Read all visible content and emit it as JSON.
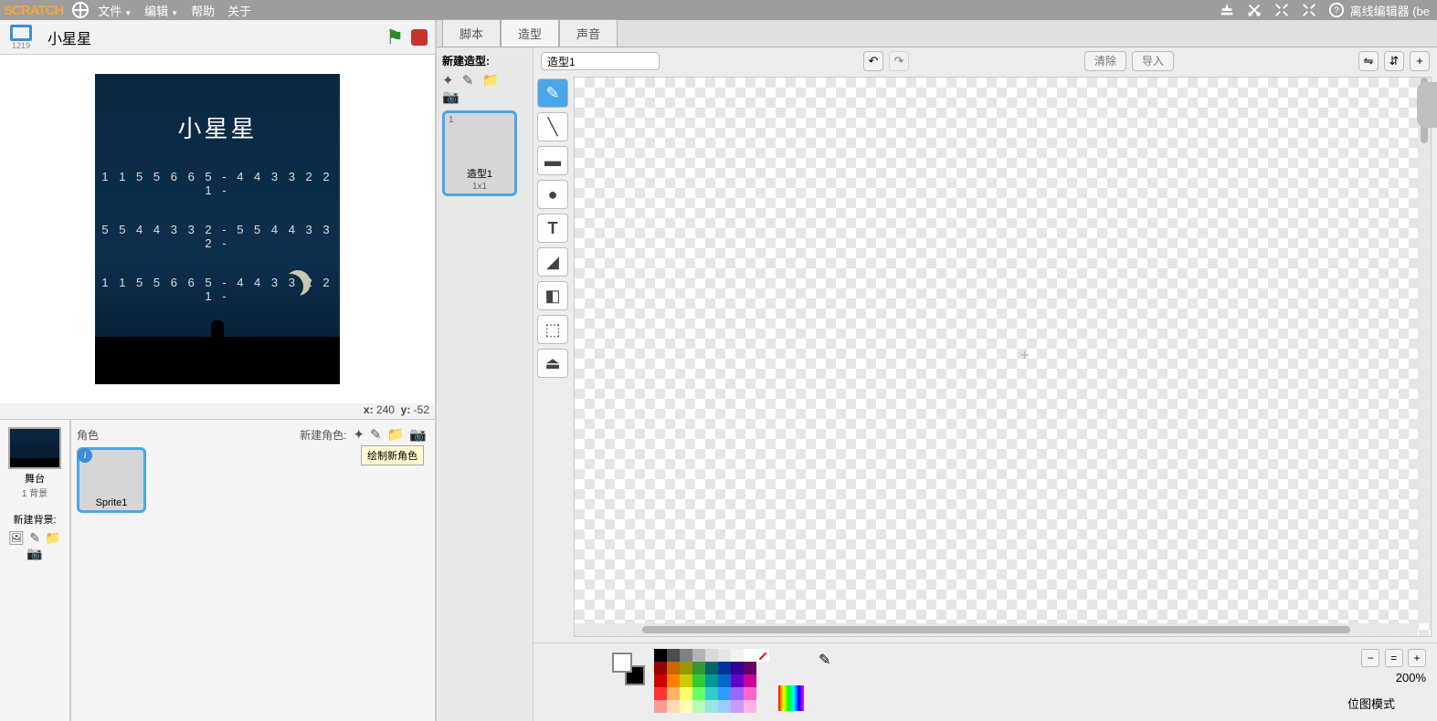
{
  "menubar": {
    "logo": "SCRATCH",
    "file": "文件",
    "edit": "编辑",
    "help": "帮助",
    "about": "关于",
    "status": "离线编辑器 (be"
  },
  "stage_header": {
    "view_num": "1219",
    "title": "小星星"
  },
  "stage_content": {
    "title": "小星星",
    "line1": "1 1 5 5 6 6 5 -  4 4 3 3 2 2 1 -",
    "line2": "5 5 4 4 3 3 2 -  5 5 4 4 3 3 2 -",
    "line3": "1 1 5 5 6 6 5 -  4 4 3 3 2 2 1 -"
  },
  "coords": {
    "xl": "x:",
    "x": "240",
    "yl": "y:",
    "y": "-52"
  },
  "stage_sel": {
    "label": "舞台",
    "sub": "1 背景",
    "new_bd": "新建背景:"
  },
  "sprite_area": {
    "label": "角色",
    "new_label": "新建角色:",
    "sprite1": "Sprite1",
    "tooltip": "绘制新角色"
  },
  "tabs": {
    "scripts": "脚本",
    "costumes": "造型",
    "sounds": "声音"
  },
  "costume_panel": {
    "header": "新建造型:",
    "thumb_num": "1",
    "thumb_name": "造型1",
    "thumb_size": "1x1"
  },
  "paint": {
    "name_input": "造型1",
    "clear": "清除",
    "import": "导入",
    "zoom": "200%",
    "mode": "位图模式"
  },
  "palette_rows": [
    [
      "#000000",
      "#4d4d4d",
      "#808080",
      "#b3b3b3",
      "#d9d9d9",
      "#e6e6e6",
      "#f2f2f2",
      "#ffffff"
    ],
    [
      "#990000",
      "#cc6600",
      "#999900",
      "#339933",
      "#006666",
      "#003399",
      "#330099",
      "#660066"
    ],
    [
      "#cc0000",
      "#ff8000",
      "#cccc00",
      "#33cc33",
      "#009999",
      "#0066cc",
      "#6600cc",
      "#cc0099"
    ],
    [
      "#ff3333",
      "#ffb366",
      "#ffff66",
      "#66ff66",
      "#33cccc",
      "#3399ff",
      "#9966ff",
      "#ff66cc"
    ],
    [
      "#ff9999",
      "#ffd9b3",
      "#ffffb3",
      "#b3ffb3",
      "#99e6e6",
      "#99ccff",
      "#cc99ff",
      "#ffb3e6"
    ]
  ]
}
